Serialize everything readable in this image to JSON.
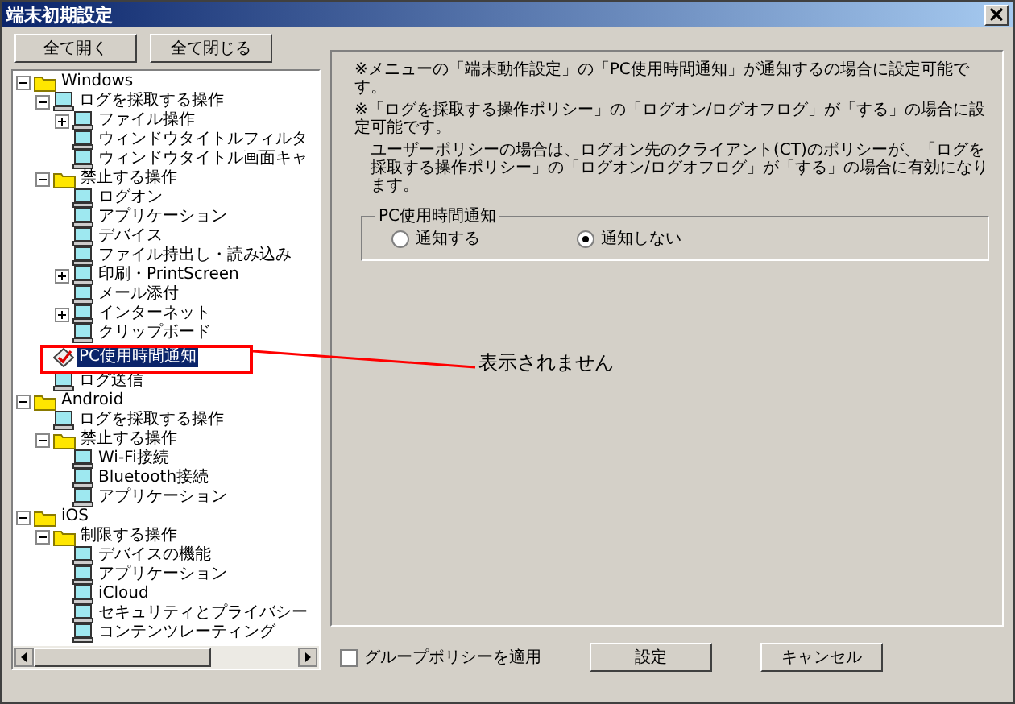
{
  "window": {
    "title": "端末初期設定"
  },
  "toolbar": [
    "全て開く",
    "全て閉じる"
  ],
  "tree": [
    {
      "label": "Windows",
      "kind": "folder",
      "expanded": true,
      "selected": false,
      "children": [
        {
          "label": "ログを採取する操作",
          "kind": "pc",
          "expanded": true,
          "selected": false,
          "children": [
            {
              "label": "ファイル操作",
              "kind": "pc",
              "expanded": false,
              "selected": false
            },
            {
              "label": "ウィンドウタイトルフィルタ",
              "kind": "pc",
              "selected": false
            },
            {
              "label": "ウィンドウタイトル画面キャ",
              "kind": "pc",
              "selected": false
            }
          ]
        },
        {
          "label": "禁止する操作",
          "kind": "folder",
          "expanded": true,
          "selected": false,
          "children": [
            {
              "label": "ログオン",
              "kind": "pc",
              "selected": false
            },
            {
              "label": "アプリケーション",
              "kind": "pc",
              "selected": false
            },
            {
              "label": "デバイス",
              "kind": "pc",
              "selected": false
            },
            {
              "label": "ファイル持出し・読み込み",
              "kind": "pc",
              "selected": false
            },
            {
              "label": "印刷・PrintScreen",
              "kind": "pc",
              "expanded": false,
              "selected": false
            },
            {
              "label": "メール添付",
              "kind": "pc",
              "selected": false
            },
            {
              "label": "インターネット",
              "kind": "pc",
              "expanded": false,
              "selected": false
            },
            {
              "label": "クリップボード",
              "kind": "pc",
              "selected": false
            }
          ]
        },
        {
          "label": "PC使用時間通知",
          "kind": "setting",
          "selected": true
        },
        {
          "label": "ログ送信",
          "kind": "pc",
          "selected": false
        }
      ]
    },
    {
      "label": "Android",
      "kind": "folder",
      "expanded": true,
      "selected": false,
      "children": [
        {
          "label": "ログを採取する操作",
          "kind": "pc",
          "selected": false
        },
        {
          "label": "禁止する操作",
          "kind": "folder",
          "expanded": true,
          "selected": false,
          "children": [
            {
              "label": "Wi-Fi接続",
              "kind": "pc",
              "selected": false
            },
            {
              "label": "Bluetooth接続",
              "kind": "pc",
              "selected": false
            },
            {
              "label": "アプリケーション",
              "kind": "pc",
              "selected": false
            }
          ]
        }
      ]
    },
    {
      "label": "iOS",
      "kind": "folder",
      "expanded": true,
      "selected": false,
      "children": [
        {
          "label": "制限する操作",
          "kind": "folder",
          "expanded": true,
          "selected": false,
          "children": [
            {
              "label": "デバイスの機能",
              "kind": "pc",
              "selected": false
            },
            {
              "label": "アプリケーション",
              "kind": "pc",
              "selected": false
            },
            {
              "label": "iCloud",
              "kind": "pc",
              "selected": false
            },
            {
              "label": "セキュリティとプライバシー",
              "kind": "pc",
              "selected": false
            },
            {
              "label": "コンテンツレーティング",
              "kind": "pc",
              "selected": false
            }
          ]
        }
      ]
    }
  ],
  "notes": [
    "※メニューの「端末動作設定」の「PC使用時間通知」が通知するの場合に設定可能です。",
    "※「ログを採取する操作ポリシー」の「ログオン/ログオフログ」が「する」の場合に設定可能です。",
    "ユーザーポリシーの場合は、ログオン先のクライアント(CT)のポリシーが、「ログを採取する操作ポリシー」の「ログオン/ログオフログ」が「する」の場合に有効になります。"
  ],
  "group": {
    "title": "PC使用時間通知",
    "options": [
      {
        "label": "通知する",
        "selected": false
      },
      {
        "label": "通知しない",
        "selected": true
      }
    ]
  },
  "footer": {
    "checkbox": {
      "label": "グループポリシーを適用",
      "checked": false
    },
    "buttons": [
      "設定",
      "キャンセル"
    ]
  },
  "annotation": {
    "text": "表示されません"
  }
}
